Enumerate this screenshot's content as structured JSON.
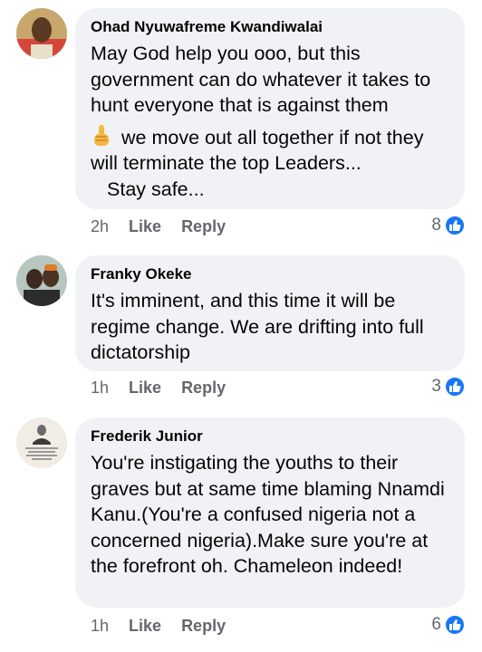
{
  "comments": [
    {
      "author": "Ohad Nyuwafreme Kwandiwalai",
      "paragraphs": [
        "May God help you ooo, but this government can do whatever it takes to hunt everyone that is against them",
        "we move out all together if not they will terminate the top Leaders...",
        "Stay safe..."
      ],
      "emoji": "pointing-up-icon",
      "time": "2h",
      "like_label": "Like",
      "reply_label": "Reply",
      "reaction_count": "8"
    },
    {
      "author": "Franky Okeke",
      "paragraphs": [
        "It's imminent, and this time it will be regime change. We are drifting into full dictatorship"
      ],
      "time": "1h",
      "like_label": "Like",
      "reply_label": "Reply",
      "reaction_count": "3"
    },
    {
      "author": "Frederik Junior",
      "paragraphs": [
        "You're instigating the youths to their graves but at same time blaming Nnamdi Kanu.(You're a confused nigeria not a concerned nigeria).Make sure you're at the forefront oh. Chameleon indeed!"
      ],
      "time": "1h",
      "like_label": "Like",
      "reply_label": "Reply",
      "reaction_count": "6"
    }
  ],
  "colors": {
    "bubble": "#f0f2f5",
    "secondary_text": "#65676b",
    "like_blue": "#1877f2"
  }
}
